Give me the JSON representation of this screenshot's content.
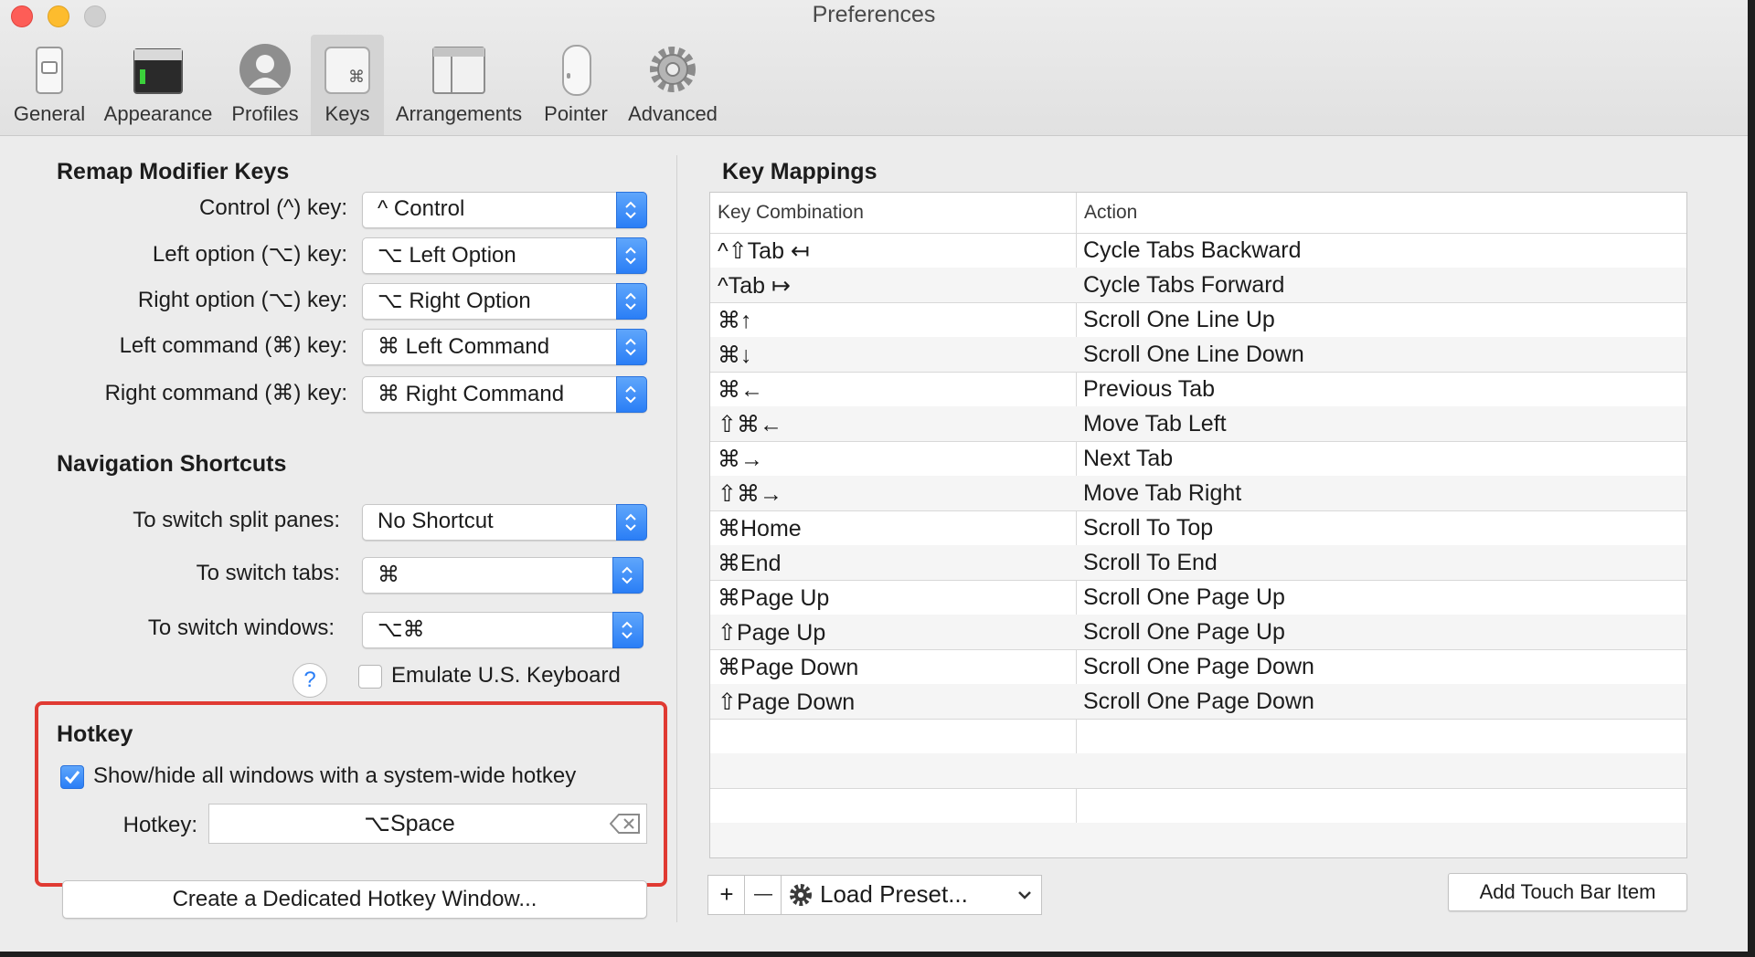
{
  "window": {
    "title": "Preferences"
  },
  "toolbar": {
    "items": [
      {
        "label": "General",
        "icon": "general-switch-icon"
      },
      {
        "label": "Appearance",
        "icon": "appearance-window-icon"
      },
      {
        "label": "Profiles",
        "icon": "profile-silhouette-icon"
      },
      {
        "label": "Keys",
        "icon": "command-key-icon",
        "active": true
      },
      {
        "label": "Arrangements",
        "icon": "arrangements-window-icon"
      },
      {
        "label": "Pointer",
        "icon": "mouse-icon"
      },
      {
        "label": "Advanced",
        "icon": "gear-icon"
      }
    ]
  },
  "remap": {
    "title": "Remap Modifier Keys",
    "rows": [
      {
        "label": "Control (^) key:",
        "value": "^ Control"
      },
      {
        "label": "Left option (⌥) key:",
        "value": "⌥ Left Option"
      },
      {
        "label": "Right option (⌥) key:",
        "value": "⌥ Right Option"
      },
      {
        "label": "Left command (⌘) key:",
        "value": "⌘ Left Command"
      },
      {
        "label": "Right command (⌘) key:",
        "value": "⌘ Right Command"
      }
    ]
  },
  "navigation": {
    "title": "Navigation Shortcuts",
    "rows": [
      {
        "label": "To switch split panes:",
        "value": "No Shortcut"
      },
      {
        "label": "To switch tabs:",
        "value": "⌘"
      },
      {
        "label": "To switch windows:",
        "value": "⌥⌘"
      }
    ],
    "help": "?",
    "emulate_label": "Emulate U.S. Keyboard",
    "emulate_checked": false
  },
  "hotkey": {
    "title": "Hotkey",
    "show_hide_label": "Show/hide all windows with a system-wide hotkey",
    "show_hide_checked": true,
    "hotkey_label": "Hotkey:",
    "hotkey_value": "⌥Space",
    "dedicated_button": "Create a Dedicated Hotkey Window..."
  },
  "key_mappings": {
    "title": "Key Mappings",
    "columns": [
      "Key Combination",
      "Action"
    ],
    "rows": [
      [
        "^⇧Tab ↤",
        "Cycle Tabs Backward"
      ],
      [
        "^Tab ↦",
        "Cycle Tabs Forward"
      ],
      [
        "⌘↑",
        "Scroll One Line Up"
      ],
      [
        "⌘↓",
        "Scroll One Line Down"
      ],
      [
        "⌘←",
        "Previous Tab"
      ],
      [
        "⇧⌘←",
        "Move Tab Left"
      ],
      [
        "⌘→",
        "Next Tab"
      ],
      [
        "⇧⌘→",
        "Move Tab Right"
      ],
      [
        "⌘Home",
        "Scroll To Top"
      ],
      [
        "⌘End",
        "Scroll To End"
      ],
      [
        "⌘Page Up",
        "Scroll One Page Up"
      ],
      [
        "⇧Page Up",
        "Scroll One Page Up"
      ],
      [
        "⌘Page Down",
        "Scroll One Page Down"
      ],
      [
        "⇧Page Down",
        "Scroll One Page Down"
      ]
    ],
    "add": "+",
    "remove": "—",
    "load_preset": "Load Preset...",
    "touch_bar": "Add Touch Bar Item"
  },
  "colors": {
    "accent": "#2a7ef6",
    "highlight": "#e03a32"
  }
}
